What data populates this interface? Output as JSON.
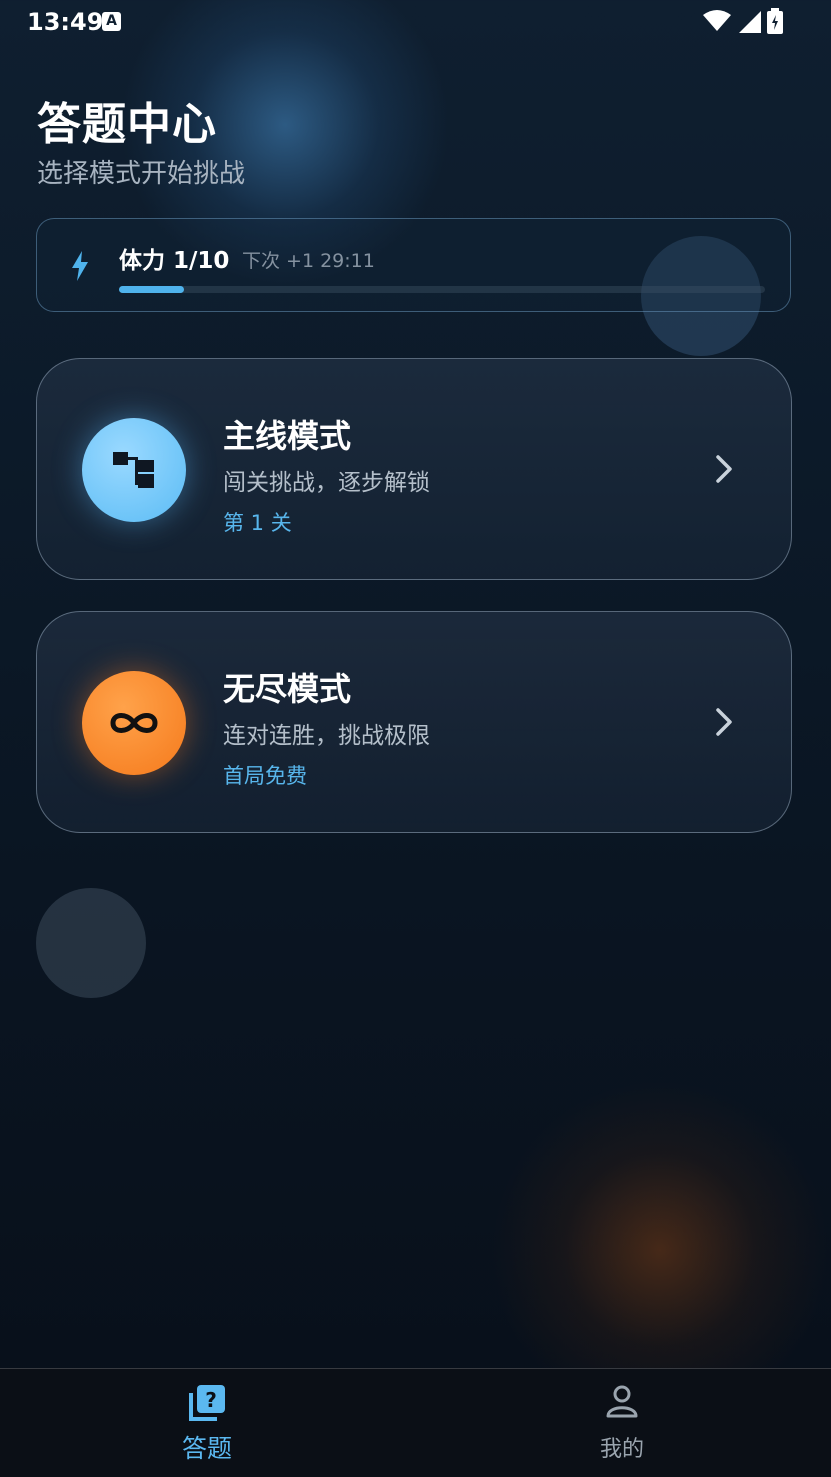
{
  "status_bar": {
    "time": "13:49",
    "indicator": "A"
  },
  "header": {
    "title": "答题中心",
    "subtitle": "选择模式开始挑战"
  },
  "stamina": {
    "label": "体力 1/10",
    "next_refill": "下次 +1 29:11",
    "progress": 0.1,
    "icon": "lightning-icon"
  },
  "modes": [
    {
      "title": "主线模式",
      "description": "闯关挑战，逐步解锁",
      "tag": "第 1 关",
      "icon": "level-tree-icon"
    },
    {
      "title": "无尽模式",
      "description": "连对连胜，挑战极限",
      "tag": "首局免费",
      "icon": "infinity-icon"
    }
  ],
  "bottom_nav": [
    {
      "label": "答题",
      "icon": "quiz-icon",
      "active": true
    },
    {
      "label": "我的",
      "icon": "profile-icon",
      "active": false
    }
  ],
  "colors": {
    "accent": "#58b6ec",
    "main_mode": "#6cc6f7",
    "endless_mode": "#f5801f",
    "background": "#0c1a29"
  }
}
